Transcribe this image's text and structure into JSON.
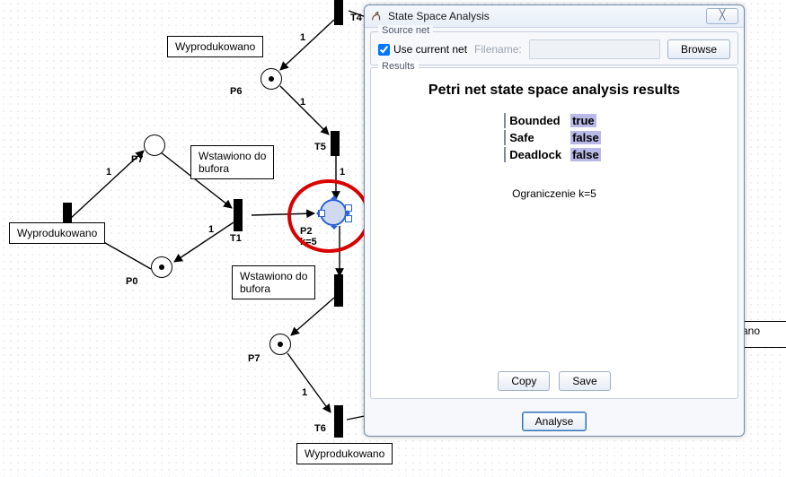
{
  "window": {
    "title": "State Space Analysis",
    "close_glyph": "╳",
    "source_group": "Source net",
    "use_current_label": "Use current net",
    "use_current_checked": true,
    "filename_label": "Filename:",
    "filename_value": "",
    "browse": "Browse",
    "results_group": "Results",
    "results_title": "Petri net state space analysis results",
    "props": {
      "bounded_k": "Bounded",
      "bounded_v": "true",
      "safe_k": "Safe",
      "safe_v": "false",
      "deadlock_k": "Deadlock",
      "deadlock_v": "false"
    },
    "caption": "Ograniczenie k=5",
    "copy": "Copy",
    "save": "Save",
    "analyse": "Analyse"
  },
  "net": {
    "places": {
      "P0": "P0",
      "P2": "P2",
      "P2_sub": "k=5",
      "P6": "P6",
      "P7_top": "P7",
      "P7_bottom": "P7"
    },
    "transitions": {
      "T1": "T1",
      "T4": "T4",
      "T5": "T5",
      "T6": "T6"
    },
    "arc_weight": "1",
    "labelboxes": {
      "wyprod_top": "Wyprodukowano",
      "wyprod_left": "Wyprodukowano",
      "wyprod_bottom": "Wyprodukowano",
      "wst_top": "Wstawiono do\nbufora",
      "wst_bottom": "Wstawiono do\nbufora"
    },
    "cutoff_right": "ano"
  }
}
